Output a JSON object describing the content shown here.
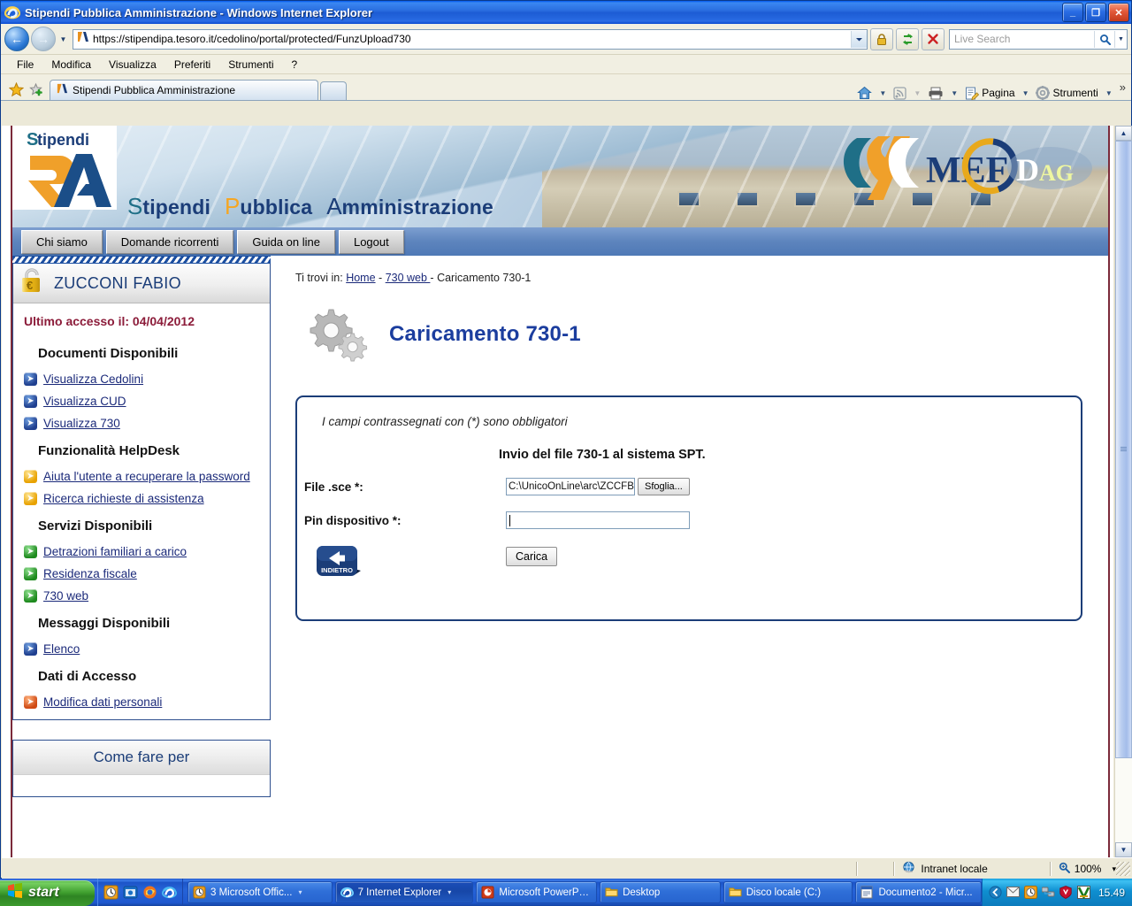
{
  "window": {
    "title": "Stipendi Pubblica Amministrazione - Windows Internet Explorer",
    "minimize_label": "_",
    "maximize_label": "❐",
    "close_label": "✕"
  },
  "browser": {
    "url": "https://stipendipa.tesoro.it/cedolino/portal/protected/FunzUpload730",
    "search_placeholder": "Live Search",
    "menus": [
      "File",
      "Modifica",
      "Visualizza",
      "Preferiti",
      "Strumenti",
      "?"
    ],
    "tab_label": "Stipendi Pubblica Amministrazione",
    "toolbar": {
      "home": "",
      "feeds": "",
      "print": "",
      "page": "Pagina",
      "tools": "Strumenti",
      "overflow": "»"
    }
  },
  "site": {
    "logo_word": {
      "s": "S",
      "rest1": "tipendi",
      "p": "P",
      "rest2": "ubblica",
      "a": "A",
      "rest3": "mministrazione"
    },
    "logo_badge_text": "tipendi",
    "mef_text": "MEF",
    "dag_d": "D",
    "dag_ag": "AG",
    "nav_tabs": [
      "Chi siamo",
      "Domande ricorrenti",
      "Guida on line",
      "Logout"
    ]
  },
  "sidebar": {
    "user_name": "ZUCCONI FABIO",
    "last_access": "Ultimo accesso il: 04/04/2012",
    "sections": [
      {
        "title": "Documenti Disponibili",
        "links": [
          {
            "label": "Visualizza Cedolini",
            "color": "blue"
          },
          {
            "label": "Visualizza CUD",
            "color": "blue"
          },
          {
            "label": "Visualizza 730",
            "color": "blue"
          }
        ]
      },
      {
        "title": "Funzionalità HelpDesk",
        "links": [
          {
            "label": "Aiuta l'utente a recuperare la password",
            "color": "yellow"
          },
          {
            "label": "Ricerca richieste di assistenza",
            "color": "yellow"
          }
        ]
      },
      {
        "title": "Servizi Disponibili",
        "links": [
          {
            "label": "Detrazioni familiari a carico",
            "color": "green"
          },
          {
            "label": "Residenza fiscale",
            "color": "green"
          },
          {
            "label": "730 web",
            "color": "green"
          }
        ]
      },
      {
        "title": "Messaggi Disponibili",
        "links": [
          {
            "label": "Elenco",
            "color": "blue"
          }
        ]
      },
      {
        "title": "Dati di Accesso",
        "links": [
          {
            "label": "Modifica dati personali",
            "color": "orange"
          }
        ]
      }
    ],
    "come_fare_per": "Come fare per"
  },
  "main": {
    "breadcrumb_prefix": "Ti trovi in:",
    "breadcrumb_home": "Home",
    "breadcrumb_sep1": "-",
    "breadcrumb_730web": "730 web ",
    "breadcrumb_sep2": "-",
    "breadcrumb_current": "Caricamento 730-1",
    "page_title": "Caricamento 730-1",
    "form": {
      "required_note": "I campi contrassegnati con (*) sono obbligatori",
      "subtitle": "Invio del file 730-1 al sistema SPT.",
      "file_label": "File .sce *:",
      "file_value": "C:\\UnicoOnLine\\arc\\ZCCFB",
      "browse_label": "Sfoglia...",
      "pin_label": "Pin dispositivo *:",
      "pin_value": "",
      "submit_label": "Carica",
      "back_label": "INDIETRO"
    }
  },
  "status": {
    "zone": "Intranet locale",
    "zoom": "100%",
    "zoom_caret": "▾"
  },
  "taskbar": {
    "start_label": "start",
    "tasks": [
      {
        "label": "3 Microsoft Offic...",
        "caret": "▾",
        "active": false
      },
      {
        "label": "7 Internet Explorer",
        "caret": "▾",
        "active": true
      },
      {
        "label": "Microsoft PowerPo...",
        "caret": "",
        "active": false
      },
      {
        "label": "Desktop",
        "caret": "",
        "active": false
      },
      {
        "label": "Disco locale (C:)",
        "caret": "",
        "active": false
      },
      {
        "label": "Documento2 - Micr...",
        "caret": "",
        "active": false
      }
    ],
    "clock": "15.49"
  },
  "colors": {
    "accent_blue": "#1b3d9e",
    "title_bar": "#0058ee",
    "maroon": "#8c1c3a",
    "panel_border": "#1b3d78",
    "taskbar": "#2663d8"
  }
}
